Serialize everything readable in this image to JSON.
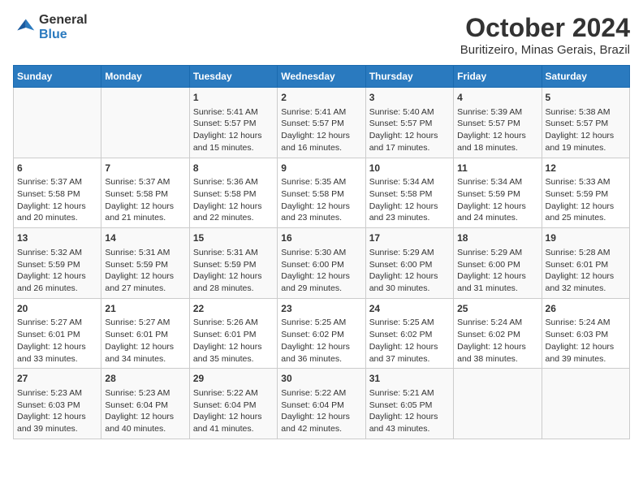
{
  "header": {
    "logo_line1": "General",
    "logo_line2": "Blue",
    "title": "October 2024",
    "subtitle": "Buritizeiro, Minas Gerais, Brazil"
  },
  "weekdays": [
    "Sunday",
    "Monday",
    "Tuesday",
    "Wednesday",
    "Thursday",
    "Friday",
    "Saturday"
  ],
  "weeks": [
    [
      {
        "day": "",
        "empty": true
      },
      {
        "day": "",
        "empty": true
      },
      {
        "day": "1",
        "sunrise": "5:41 AM",
        "sunset": "5:57 PM",
        "daylight": "12 hours and 15 minutes."
      },
      {
        "day": "2",
        "sunrise": "5:41 AM",
        "sunset": "5:57 PM",
        "daylight": "12 hours and 16 minutes."
      },
      {
        "day": "3",
        "sunrise": "5:40 AM",
        "sunset": "5:57 PM",
        "daylight": "12 hours and 17 minutes."
      },
      {
        "day": "4",
        "sunrise": "5:39 AM",
        "sunset": "5:57 PM",
        "daylight": "12 hours and 18 minutes."
      },
      {
        "day": "5",
        "sunrise": "5:38 AM",
        "sunset": "5:57 PM",
        "daylight": "12 hours and 19 minutes."
      }
    ],
    [
      {
        "day": "6",
        "sunrise": "5:37 AM",
        "sunset": "5:58 PM",
        "daylight": "12 hours and 20 minutes."
      },
      {
        "day": "7",
        "sunrise": "5:37 AM",
        "sunset": "5:58 PM",
        "daylight": "12 hours and 21 minutes."
      },
      {
        "day": "8",
        "sunrise": "5:36 AM",
        "sunset": "5:58 PM",
        "daylight": "12 hours and 22 minutes."
      },
      {
        "day": "9",
        "sunrise": "5:35 AM",
        "sunset": "5:58 PM",
        "daylight": "12 hours and 23 minutes."
      },
      {
        "day": "10",
        "sunrise": "5:34 AM",
        "sunset": "5:58 PM",
        "daylight": "12 hours and 23 minutes."
      },
      {
        "day": "11",
        "sunrise": "5:34 AM",
        "sunset": "5:59 PM",
        "daylight": "12 hours and 24 minutes."
      },
      {
        "day": "12",
        "sunrise": "5:33 AM",
        "sunset": "5:59 PM",
        "daylight": "12 hours and 25 minutes."
      }
    ],
    [
      {
        "day": "13",
        "sunrise": "5:32 AM",
        "sunset": "5:59 PM",
        "daylight": "12 hours and 26 minutes."
      },
      {
        "day": "14",
        "sunrise": "5:31 AM",
        "sunset": "5:59 PM",
        "daylight": "12 hours and 27 minutes."
      },
      {
        "day": "15",
        "sunrise": "5:31 AM",
        "sunset": "5:59 PM",
        "daylight": "12 hours and 28 minutes."
      },
      {
        "day": "16",
        "sunrise": "5:30 AM",
        "sunset": "6:00 PM",
        "daylight": "12 hours and 29 minutes."
      },
      {
        "day": "17",
        "sunrise": "5:29 AM",
        "sunset": "6:00 PM",
        "daylight": "12 hours and 30 minutes."
      },
      {
        "day": "18",
        "sunrise": "5:29 AM",
        "sunset": "6:00 PM",
        "daylight": "12 hours and 31 minutes."
      },
      {
        "day": "19",
        "sunrise": "5:28 AM",
        "sunset": "6:01 PM",
        "daylight": "12 hours and 32 minutes."
      }
    ],
    [
      {
        "day": "20",
        "sunrise": "5:27 AM",
        "sunset": "6:01 PM",
        "daylight": "12 hours and 33 minutes."
      },
      {
        "day": "21",
        "sunrise": "5:27 AM",
        "sunset": "6:01 PM",
        "daylight": "12 hours and 34 minutes."
      },
      {
        "day": "22",
        "sunrise": "5:26 AM",
        "sunset": "6:01 PM",
        "daylight": "12 hours and 35 minutes."
      },
      {
        "day": "23",
        "sunrise": "5:25 AM",
        "sunset": "6:02 PM",
        "daylight": "12 hours and 36 minutes."
      },
      {
        "day": "24",
        "sunrise": "5:25 AM",
        "sunset": "6:02 PM",
        "daylight": "12 hours and 37 minutes."
      },
      {
        "day": "25",
        "sunrise": "5:24 AM",
        "sunset": "6:02 PM",
        "daylight": "12 hours and 38 minutes."
      },
      {
        "day": "26",
        "sunrise": "5:24 AM",
        "sunset": "6:03 PM",
        "daylight": "12 hours and 39 minutes."
      }
    ],
    [
      {
        "day": "27",
        "sunrise": "5:23 AM",
        "sunset": "6:03 PM",
        "daylight": "12 hours and 39 minutes."
      },
      {
        "day": "28",
        "sunrise": "5:23 AM",
        "sunset": "6:04 PM",
        "daylight": "12 hours and 40 minutes."
      },
      {
        "day": "29",
        "sunrise": "5:22 AM",
        "sunset": "6:04 PM",
        "daylight": "12 hours and 41 minutes."
      },
      {
        "day": "30",
        "sunrise": "5:22 AM",
        "sunset": "6:04 PM",
        "daylight": "12 hours and 42 minutes."
      },
      {
        "day": "31",
        "sunrise": "5:21 AM",
        "sunset": "6:05 PM",
        "daylight": "12 hours and 43 minutes."
      },
      {
        "day": "",
        "empty": true
      },
      {
        "day": "",
        "empty": true
      }
    ]
  ],
  "labels": {
    "sunrise": "Sunrise:",
    "sunset": "Sunset:",
    "daylight": "Daylight:"
  }
}
